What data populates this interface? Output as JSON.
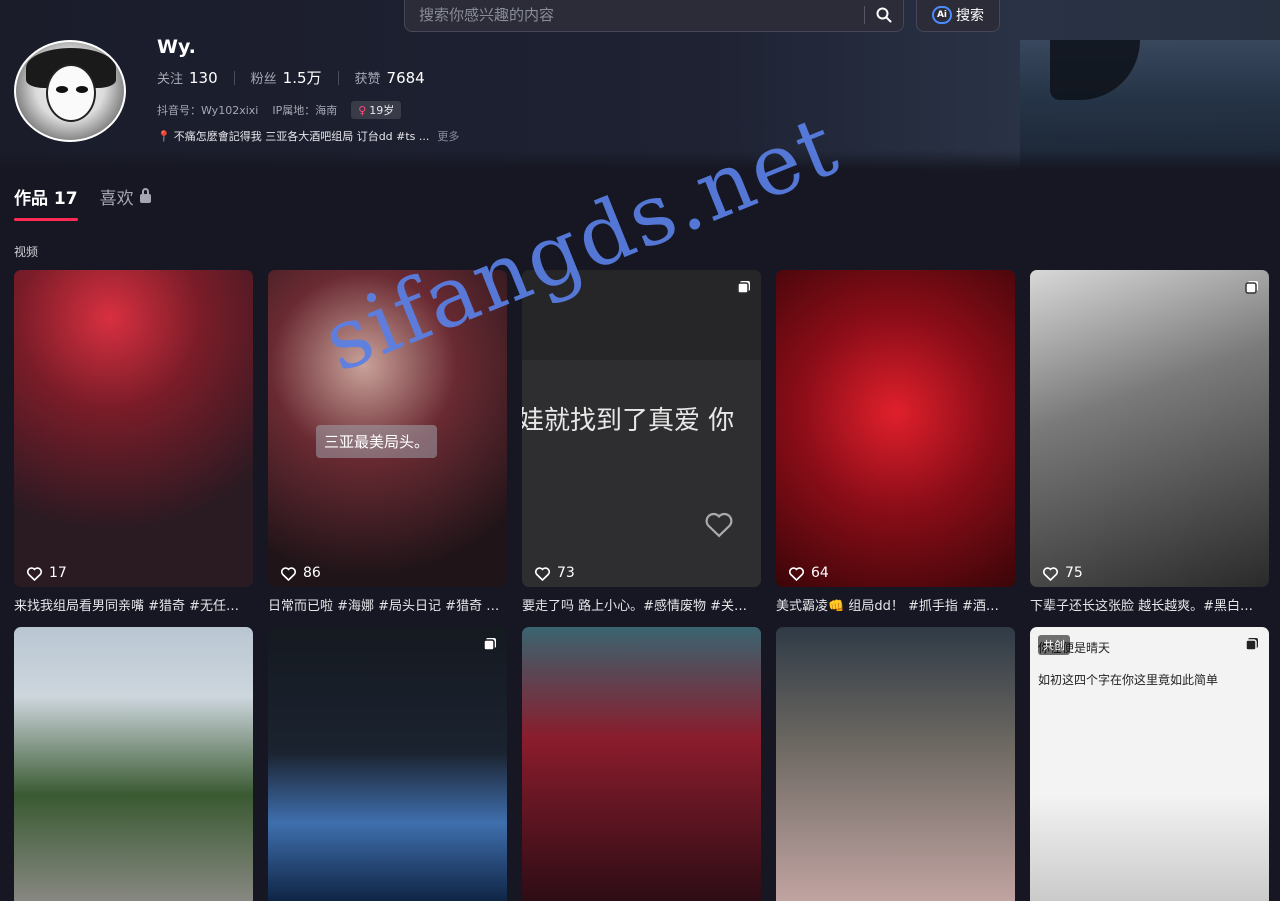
{
  "search": {
    "placeholder": "搜索你感兴趣的内容",
    "ai_logo": "Ai",
    "ai_label": "搜索"
  },
  "profile": {
    "name": "Wy.",
    "following_label": "关注",
    "following": "130",
    "followers_label": "粉丝",
    "followers": "1.5万",
    "likes_label": "获赞",
    "likes": "7684",
    "douyin_id": "抖音号：Wy102xixi",
    "ip": "IP属地：海南",
    "age": "19岁",
    "bio": "不痛怎麼會記得我 三亚各大酒吧组局 订台dd #ts ...",
    "more": "更多"
  },
  "tabs": [
    {
      "label": "作品 17"
    },
    {
      "label": "喜欢"
    }
  ],
  "section_label": "视频",
  "videos": [
    {
      "likes": "17",
      "caption": "来找我组局看男同亲嘴 #猎奇 #无任…"
    },
    {
      "likes": "86",
      "caption": "日常而已啦 #海娜 #局头日记 #猎奇 …",
      "overlay": "三亚最美局头。"
    },
    {
      "likes": "73",
      "caption": "要走了吗 路上小心。#感情废物 #关…",
      "overlay": "娃就找到了真爱 你"
    },
    {
      "likes": "64",
      "caption": "美式霸凌👊 组局dd！ #抓手指 #酒…"
    },
    {
      "likes": "75",
      "caption": "下辈子还长这张脸 越长越爽。#黑白…"
    },
    {
      "likes": "",
      "caption": ""
    },
    {
      "likes": "",
      "caption": ""
    },
    {
      "likes": "",
      "caption": ""
    },
    {
      "likes": "",
      "caption": ""
    },
    {
      "likes": "",
      "caption": "",
      "badge": "共创",
      "text1": "如初这四个字在你这里竟如此简单",
      "text2": "你在便是晴天"
    }
  ],
  "watermark": "sifangds.net",
  "colors": {
    "accent": "#fe2c55",
    "background": "#161722",
    "watermark": "#5a80e6"
  }
}
